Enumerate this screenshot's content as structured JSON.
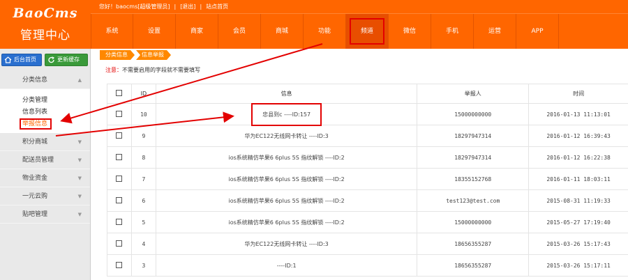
{
  "logo": {
    "en": "BaoCms",
    "cn": "管理中心"
  },
  "topbar": {
    "greeting": "您好！baocms[超级管理员]",
    "logout": "[退出]",
    "site_home": "站点首页",
    "sep": "|"
  },
  "nav": [
    "系统",
    "设置",
    "商家",
    "会员",
    "商城",
    "功能",
    "频道",
    "微信",
    "手机",
    "运营",
    "APP"
  ],
  "sidebar": {
    "home_button": "后台首页",
    "cache_button": "更新缓存",
    "groups": [
      {
        "label": "分类信息",
        "arrow": "▲",
        "items": [
          "分类管理",
          "信息列表",
          "举报信息"
        ]
      },
      {
        "label": "积分商城",
        "arrow": "▼"
      },
      {
        "label": "配送员管理",
        "arrow": "▼"
      },
      {
        "label": "物业资金",
        "arrow": "▼"
      },
      {
        "label": "一元云购",
        "arrow": "▼"
      },
      {
        "label": "贴吧管理",
        "arrow": "▼"
      }
    ]
  },
  "breadcrumb": [
    "分类信息",
    "信息举报"
  ],
  "note": {
    "prefix": "注意：",
    "text": "不需要启用的字段就不需要填写"
  },
  "table": {
    "headers": [
      "ID",
      "信息",
      "举报人",
      "时间"
    ],
    "rows": [
      {
        "id": "10",
        "info": "忠县到c ----ID:157",
        "reporter": "15000000000",
        "time": "2016-01-13 11:13:01"
      },
      {
        "id": "9",
        "info": "华为EC122无线网卡转让 ----ID:3",
        "reporter": "18297947314",
        "time": "2016-01-12 16:39:43"
      },
      {
        "id": "8",
        "info": "ios系统精仿苹果6 6plus 5S 指纹解锁 ----ID:2",
        "reporter": "18297947314",
        "time": "2016-01-12 16:22:38"
      },
      {
        "id": "7",
        "info": "ios系统精仿苹果6 6plus 5S 指纹解锁 ----ID:2",
        "reporter": "18355152768",
        "time": "2016-01-11 18:03:11"
      },
      {
        "id": "6",
        "info": "ios系统精仿苹果6 6plus 5S 指纹解锁 ----ID:2",
        "reporter": "test123@test.com",
        "time": "2015-08-31 11:19:33"
      },
      {
        "id": "5",
        "info": "ios系统精仿苹果6 6plus 5S 指纹解锁 ----ID:2",
        "reporter": "15000000000",
        "time": "2015-05-27 17:19:40"
      },
      {
        "id": "4",
        "info": "华为EC122无线网卡转让 ----ID:3",
        "reporter": "18656355287",
        "time": "2015-03-26 15:17:43"
      },
      {
        "id": "3",
        "info": "----ID:1",
        "reporter": "18656355287",
        "time": "2015-03-26 15:17:11"
      }
    ]
  },
  "colors": {
    "brand": "#ff6600",
    "annotation": "#e30000"
  }
}
